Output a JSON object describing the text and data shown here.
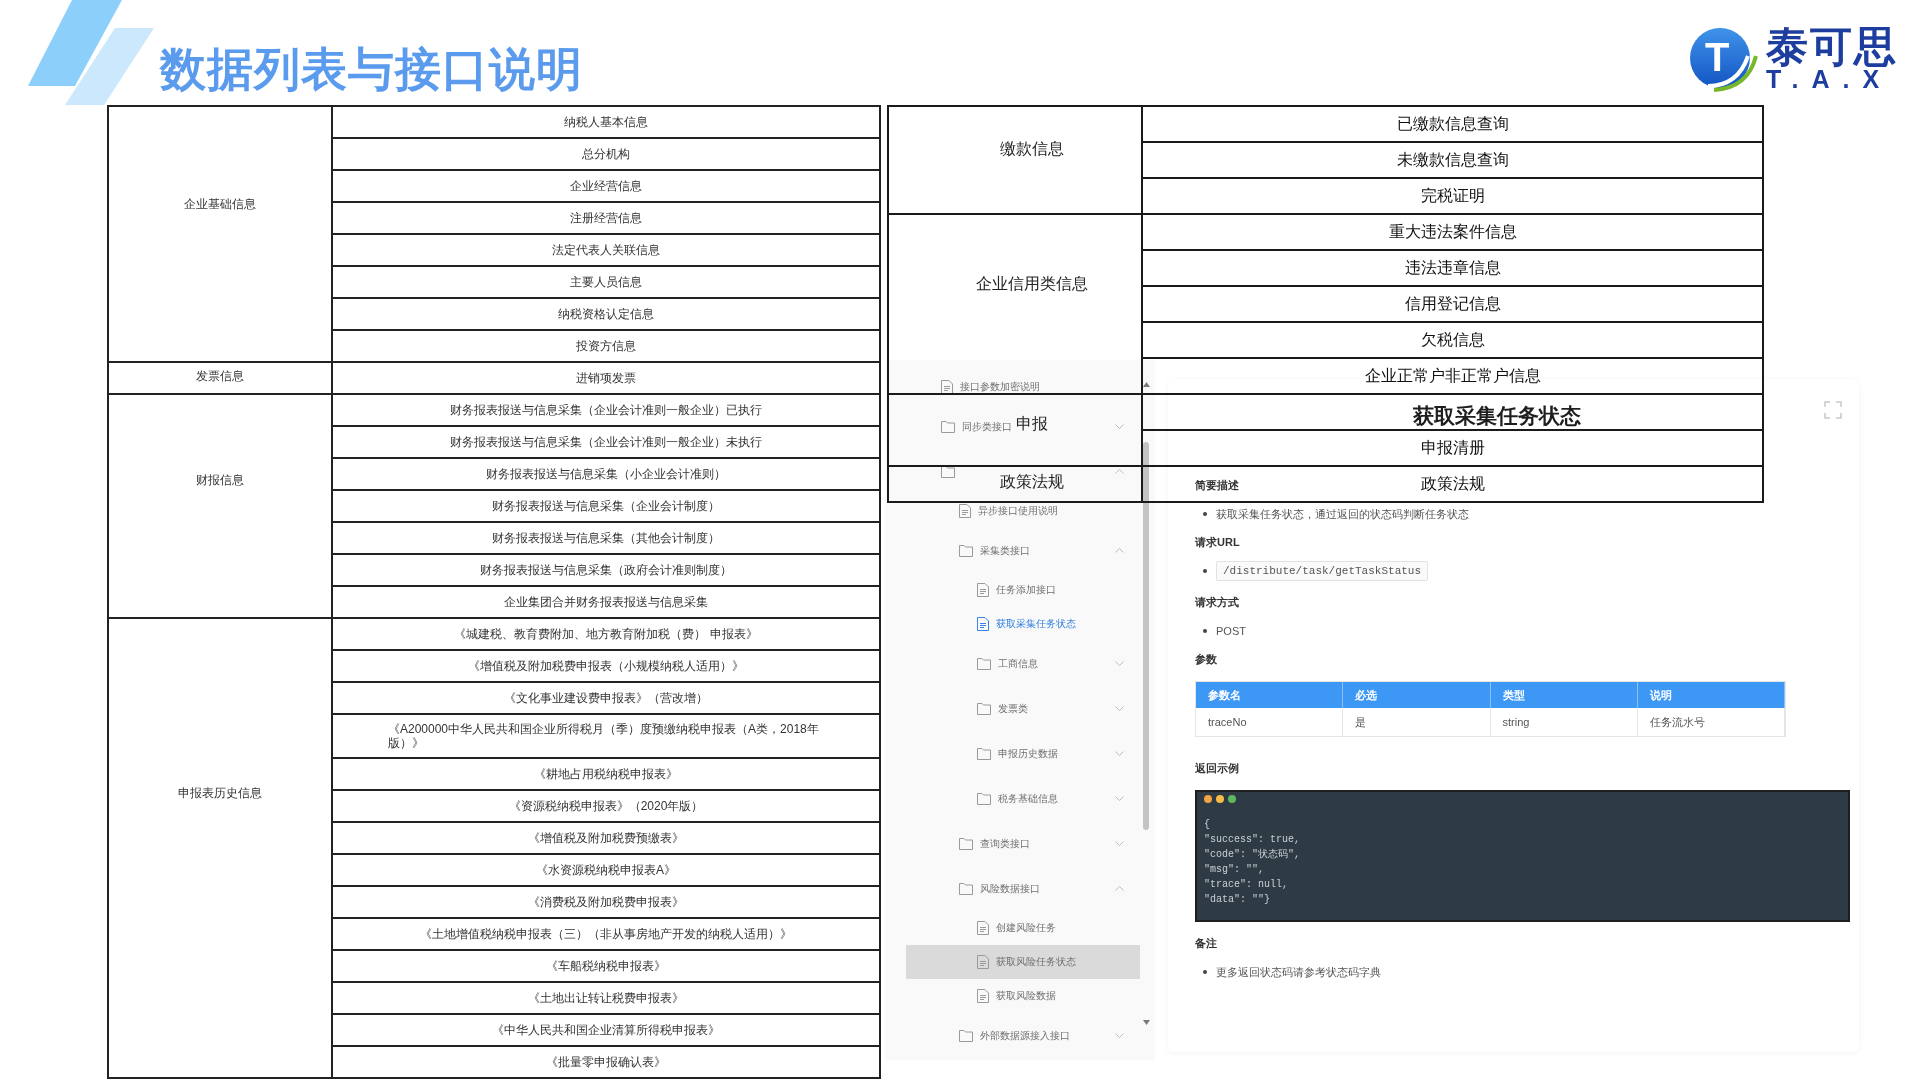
{
  "header": {
    "title": "数据列表与接口说明",
    "logo": {
      "mark": "T",
      "name": "泰可思",
      "subtitle": "T.A.X"
    }
  },
  "left_table": {
    "groups": [
      {
        "category": "企业基础信息",
        "items": [
          "纳税人基本信息",
          "总分机构",
          "企业经营信息",
          "注册经营信息",
          "法定代表人关联信息",
          "主要人员信息",
          "纳税资格认定信息",
          "投资方信息"
        ]
      },
      {
        "category": "发票信息",
        "items": [
          "进销项发票"
        ]
      },
      {
        "category": "财报信息",
        "items": [
          "财务报表报送与信息采集（企业会计准则一般企业）已执行",
          "财务报表报送与信息采集（企业会计准则一般企业）未执行",
          "财务报表报送与信息采集（小企业会计准则）",
          "财务报表报送与信息采集（企业会计制度）",
          "财务报表报送与信息采集（其他会计制度）",
          "财务报表报送与信息采集（政府会计准则制度）",
          "企业集团合并财务报表报送与信息采集"
        ]
      },
      {
        "category": "申报表历史信息",
        "items": [
          "《城建税、教育费附加、地方教育附加税（费） 申报表》",
          "《增值税及附加税费申报表（小规模纳税人适用）》",
          "《文化事业建设费申报表》（营改增）",
          "《A200000中华人民共和国企业所得税月（季）度预缴纳税申报表（A类，2018年版）》",
          "《耕地占用税纳税申报表》",
          "《资源税纳税申报表》（2020年版）",
          "《增值税及附加税费预缴表》",
          "《水资源税纳税申报表A》",
          "《消费税及附加税费申报表》",
          "《土地增值税纳税申报表（三）（非从事房地产开发的纳税人适用）》",
          "《车船税纳税申报表》",
          "《土地出让转让税费申报表》",
          "《中华人民共和国企业清算所得税申报表》",
          "《批量零申报确认表》"
        ]
      }
    ]
  },
  "right_table": {
    "groups": [
      {
        "category": "缴款信息",
        "items": [
          {
            "kind": "text",
            "text": "已缴款信息查询"
          },
          {
            "kind": "text",
            "text": "未缴款信息查询"
          },
          {
            "kind": "text",
            "text": "完税证明"
          }
        ]
      },
      {
        "category": "企业信用类信息",
        "items": [
          {
            "kind": "text",
            "text": "重大违法案件信息"
          },
          {
            "kind": "text",
            "text": "违法违章信息"
          },
          {
            "kind": "text",
            "text": "信用登记信息"
          },
          {
            "kind": "text",
            "text": "欠税信息"
          },
          {
            "kind": "text",
            "text": "企业正常户非正常户信息"
          }
        ]
      },
      {
        "category": "申报",
        "items": [
          {
            "kind": "obscured"
          },
          {
            "kind": "text",
            "text": "申报清册"
          }
        ]
      },
      {
        "category": "政策法规",
        "items": [
          {
            "kind": "text",
            "text": "政策法规"
          }
        ]
      }
    ]
  },
  "api_doc": {
    "sidebar": {
      "tree": [
        {
          "kind": "doc",
          "label": "接口参数加密说明",
          "selected": false,
          "highlighted": false
        },
        {
          "kind": "folder",
          "label": "同步类接口",
          "expanded": false,
          "selected": false,
          "highlighted": false
        },
        {
          "kind": "folder",
          "expanded": true,
          "selected": false,
          "highlighted": false,
          "children": [
            {
              "kind": "doc",
              "label": "异步接口使用说明",
              "selected": false,
              "highlighted": false
            },
            {
              "kind": "folder",
              "label": "采集类接口",
              "expanded": true,
              "selected": false,
              "highlighted": false,
              "children": [
                {
                  "kind": "doc",
                  "label": "任务添加接口",
                  "selected": false,
                  "highlighted": false
                },
                {
                  "kind": "doc",
                  "label": "获取采集任务状态",
                  "selected": true,
                  "highlighted": false
                },
                {
                  "kind": "folder",
                  "label": "工商信息",
                  "expanded": false,
                  "selected": false,
                  "highlighted": false
                },
                {
                  "kind": "folder",
                  "label": "发票类",
                  "expanded": false,
                  "selected": false,
                  "highlighted": false
                },
                {
                  "kind": "folder",
                  "label": "申报历史数据",
                  "expanded": false,
                  "selected": false,
                  "highlighted": false
                },
                {
                  "kind": "folder",
                  "label": "税务基础信息",
                  "expanded": false,
                  "selected": false,
                  "highlighted": false
                }
              ]
            },
            {
              "kind": "folder",
              "label": "查询类接口",
              "expanded": false,
              "selected": false,
              "highlighted": false
            },
            {
              "kind": "folder",
              "label": "风险数据接口",
              "expanded": true,
              "selected": false,
              "highlighted": false,
              "children": [
                {
                  "kind": "doc",
                  "label": "创建风险任务",
                  "selected": false,
                  "highlighted": false
                },
                {
                  "kind": "doc",
                  "label": "获取风险任务状态",
                  "selected": false,
                  "highlighted": true
                },
                {
                  "kind": "doc",
                  "label": "获取风险数据",
                  "selected": false,
                  "highlighted": false
                }
              ]
            },
            {
              "kind": "folder",
              "label": "外部数据源接入接口",
              "expanded": false,
              "selected": false,
              "highlighted": false
            }
          ]
        }
      ]
    },
    "page": {
      "title": "获取采集任务状态",
      "sections": [
        {
          "heading": "简要描述",
          "kind": "bullet",
          "text": "获取采集任务状态，通过返回的状态码判断任务状态"
        },
        {
          "heading": "请求URL",
          "kind": "code_bullet",
          "text": "/distribute/task/getTaskStatus"
        },
        {
          "heading": "请求方式",
          "kind": "bullet",
          "text": "POST"
        },
        {
          "heading": "参数",
          "kind": "table",
          "columns": [
            "参数名",
            "必选",
            "类型",
            "说明"
          ],
          "rows": [
            [
              "traceNo",
              "是",
              "string",
              "任务流水号"
            ]
          ]
        },
        {
          "heading": "返回示例",
          "kind": "code_block",
          "lines": [
            "{",
            "\"success\": true,",
            "\"code\": \"状态码\",",
            "\"msg\": \"\",",
            "\"trace\": null,",
            "\"data\": \"\"}"
          ]
        },
        {
          "heading": "备注",
          "kind": "bullet",
          "text": "更多返回状态码请参考状态码字典"
        }
      ]
    }
  }
}
